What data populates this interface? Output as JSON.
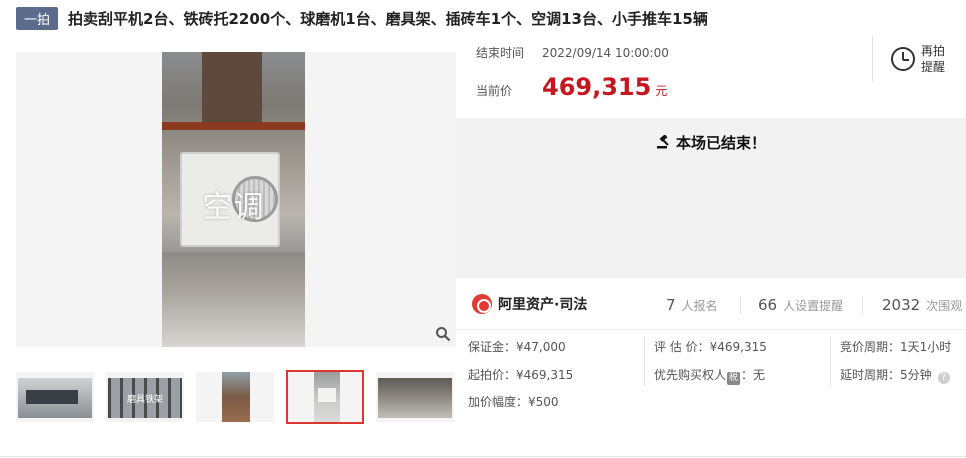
{
  "badge": "一拍",
  "title": "拍卖刮平机2台、铁砖托2200个、球磨机1台、磨具架、插砖车1个、空调13台、小手推车15辆",
  "main_image": {
    "overlay_text": "空调",
    "zoom_icon": "magnifier-icon"
  },
  "thumbnails": [
    {
      "caption": ""
    },
    {
      "caption": "磨具铁架"
    },
    {
      "caption": ""
    },
    {
      "caption": "",
      "selected": true
    },
    {
      "caption": ""
    }
  ],
  "auction": {
    "end_label": "结束时间",
    "end_time": "2022/09/14 10:00:00",
    "price_label": "当前价",
    "price": "469,315",
    "price_unit": "元",
    "price_color": "#c6161f"
  },
  "remind": {
    "line1": "再拍",
    "line2": "提醒",
    "icon": "alarm-clock-icon"
  },
  "status": {
    "icon": "gavel-icon",
    "text": "本场已结束！"
  },
  "platform": {
    "name": "阿里资产·司法",
    "stats": [
      {
        "num": "7",
        "label": "人报名"
      },
      {
        "num": "66",
        "label": "人设置提醒"
      },
      {
        "num": "2032",
        "label": "次围观"
      }
    ]
  },
  "details": {
    "deposit": "保证金：¥47,000",
    "start_price": "起拍价：¥469,315",
    "increment": "加价幅度：¥500",
    "appraisal": "评 估 价：¥469,315",
    "priority_prefix": "优先购买权人",
    "priority_tag": "税",
    "priority_suffix": "：无",
    "cycle": "竞价周期：1天1小时",
    "delay": "延时周期：5分钟",
    "help_icon": "question-icon"
  }
}
